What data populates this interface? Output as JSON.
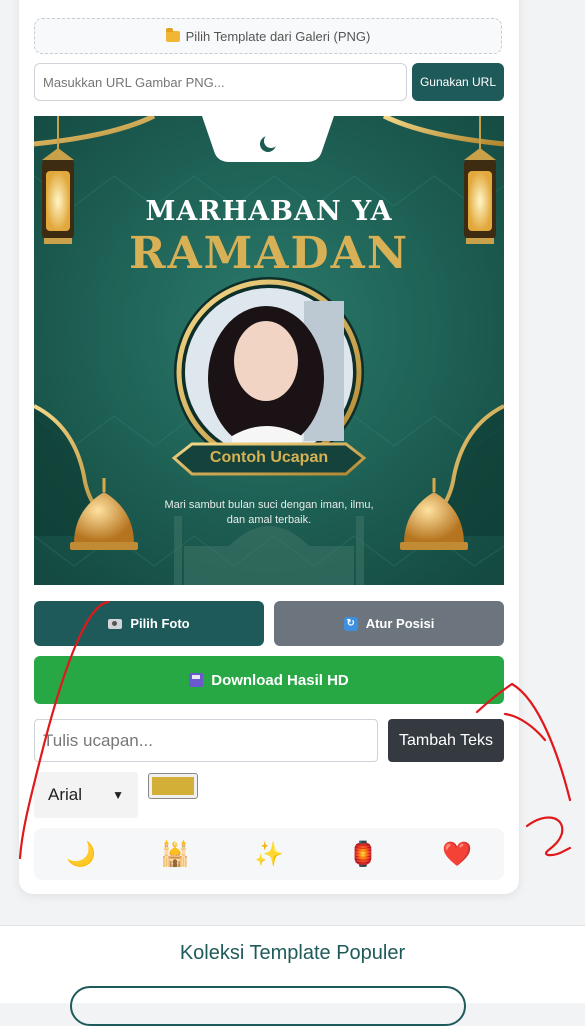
{
  "gallery": {
    "label": "Pilih Template dari Galeri (PNG)",
    "icon": "folder-icon"
  },
  "url": {
    "placeholder": "Masukkan URL Gambar PNG...",
    "button_label": "Gunakan URL"
  },
  "preview": {
    "title_line1": "MARHABAN YA",
    "title_line2": "RAMADAN",
    "label": "Contoh Ucapan",
    "subtitle": "Mari sambut bulan suci dengan iman, ilmu, dan amal terbaik.",
    "colors": {
      "background": "#1d5c52",
      "gold": "#d8b055"
    }
  },
  "actions": {
    "photo_label": "Pilih Foto",
    "position_label": "Atur Posisi",
    "download_label": "Download Hasil HD"
  },
  "text_tools": {
    "placeholder": "Tulis ucapan...",
    "add_button": "Tambah Teks",
    "font_selected": "Arial",
    "color": "#d4af37"
  },
  "emojis": [
    "🌙",
    "🕌",
    "✨",
    "🏮",
    "❤️"
  ],
  "section": {
    "title": "Koleksi Template Populer"
  },
  "colors": {
    "accent": "#1f5a5b",
    "secondary": "#6c757d",
    "success": "#28a745",
    "dark": "#343a40"
  }
}
